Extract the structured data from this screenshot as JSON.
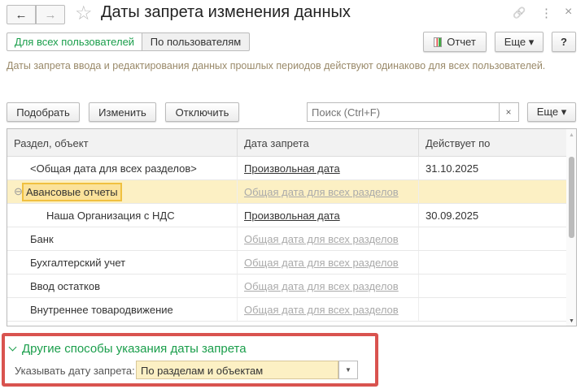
{
  "header": {
    "title": "Даты запрета изменения данных",
    "back": "←",
    "forward": "→",
    "star": "☆",
    "link_icon": "🔗",
    "more_icon": "⋮",
    "close_icon": "×"
  },
  "tabs": [
    {
      "label": "Для всех пользователей",
      "active": true
    },
    {
      "label": "По пользователям",
      "active": false
    }
  ],
  "top_buttons": {
    "report": "Отчет",
    "more": "Еще ▾",
    "help": "?"
  },
  "description": "Даты запрета ввода и редактирования данных прошлых периодов действуют одинаково для всех пользователей.",
  "toolbar": {
    "pick": "Подобрать",
    "edit": "Изменить",
    "disable": "Отключить",
    "search_placeholder": "Поиск (Ctrl+F)",
    "clear": "×",
    "more": "Еще ▾"
  },
  "table": {
    "columns": [
      "Раздел, объект",
      "Дата запрета",
      "Действует по"
    ],
    "rows": [
      {
        "name": "<Общая дата для всех разделов>",
        "date_type": "Произвольная дата",
        "until": "31.10.2025",
        "indent": 1,
        "link": "dark"
      },
      {
        "name": "Авансовые отчеты",
        "date_type": "Общая дата для всех разделов",
        "until": "",
        "indent": 0,
        "link": "gray",
        "selected": true,
        "expander": "⊖"
      },
      {
        "name": "Наша Организация с НДС",
        "date_type": "Произвольная дата",
        "until": "30.09.2025",
        "indent": 2,
        "link": "dark"
      },
      {
        "name": "Банк",
        "date_type": "Общая дата для всех разделов",
        "until": "",
        "indent": 0,
        "link": "gray"
      },
      {
        "name": "Бухгалтерский учет",
        "date_type": "Общая дата для всех разделов",
        "until": "",
        "indent": 0,
        "link": "gray"
      },
      {
        "name": "Ввод остатков",
        "date_type": "Общая дата для всех разделов",
        "until": "",
        "indent": 0,
        "link": "gray"
      },
      {
        "name": "Внутреннее товародвижение",
        "date_type": "Общая дата для всех разделов",
        "until": "",
        "indent": 0,
        "link": "gray"
      }
    ]
  },
  "other": {
    "title": "Другие способы указания даты запрета",
    "label": "Указывать дату запрета:",
    "value": "По разделам и объектам",
    "chevron": "⌄"
  },
  "colors": {
    "accent_green": "#1a9e4b",
    "selected_row": "#fcf0c4",
    "highlight_border": "#d9534f"
  }
}
